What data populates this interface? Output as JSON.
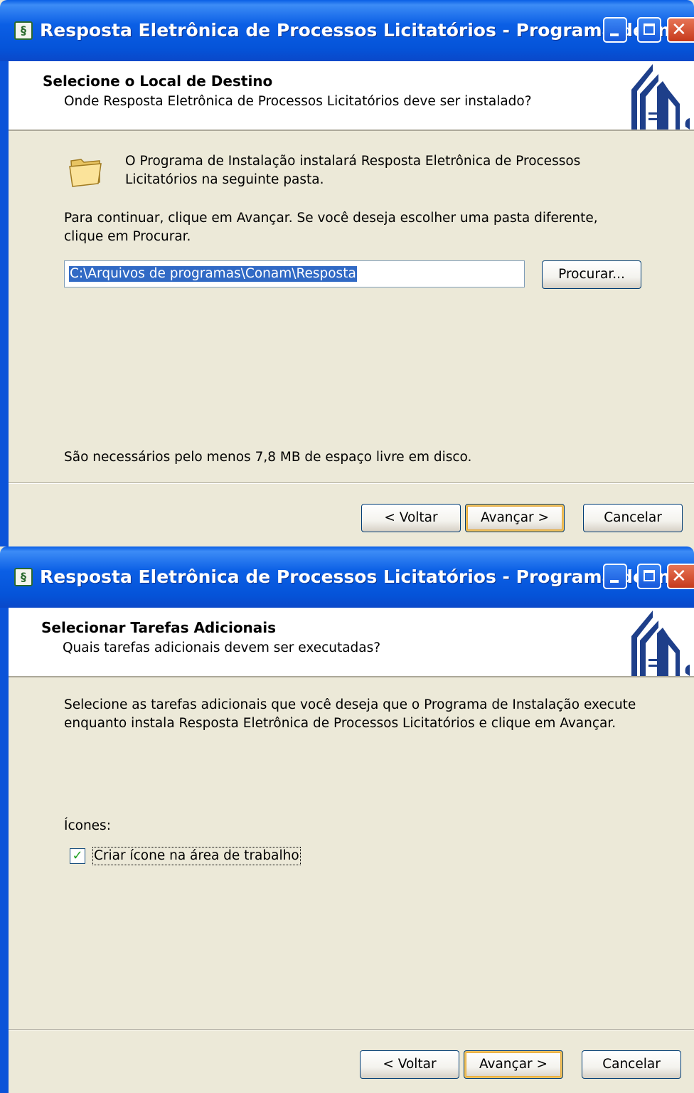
{
  "window1": {
    "title": "Resposta Eletrônica de Processos Licitatórios - Programa de In...",
    "header_title": "Selecione o Local de Destino",
    "header_subtitle": "Onde Resposta Eletrônica de Processos Licitatórios deve ser instalado?",
    "info_line1": "O Programa de Instalação instalará Resposta Eletrônica de Processos",
    "info_line2": "Licitatórios na seguinte pasta.",
    "instruction_line1": "Para continuar, clique em Avançar. Se você deseja escolher uma pasta diferente,",
    "instruction_line2": "clique em Procurar.",
    "path_value": "C:\\Arquivos de programas\\Conam\\Resposta",
    "browse_label": "Procurar...",
    "disk_space": "São necessários pelo menos 7,8 MB de espaço livre em disco.",
    "back_label": "< Voltar",
    "next_label": "Avançar >",
    "cancel_label": "Cancelar"
  },
  "window2": {
    "title": "Resposta Eletrônica de Processos Licitatórios - Programa de In...",
    "header_title": "Selecionar Tarefas Adicionais",
    "header_subtitle": "Quais tarefas adicionais devem ser executadas?",
    "instruction_line1": "Selecione as tarefas adicionais que você deseja que o Programa de Instalação execute",
    "instruction_line2": "enquanto instala Resposta Eletrônica de Processos Licitatórios e clique em Avançar.",
    "group_label": "Ícones:",
    "task_label": "Criar ícone na área de trabalho",
    "task_checked": true,
    "back_label": "< Voltar",
    "next_label": "Avançar >",
    "cancel_label": "Cancelar"
  },
  "icons": {
    "app": "app-icon",
    "folder": "folder-icon",
    "logo": "installer-logo",
    "minimize": "minimize-icon",
    "maximize": "maximize-icon",
    "close": "close-icon"
  }
}
